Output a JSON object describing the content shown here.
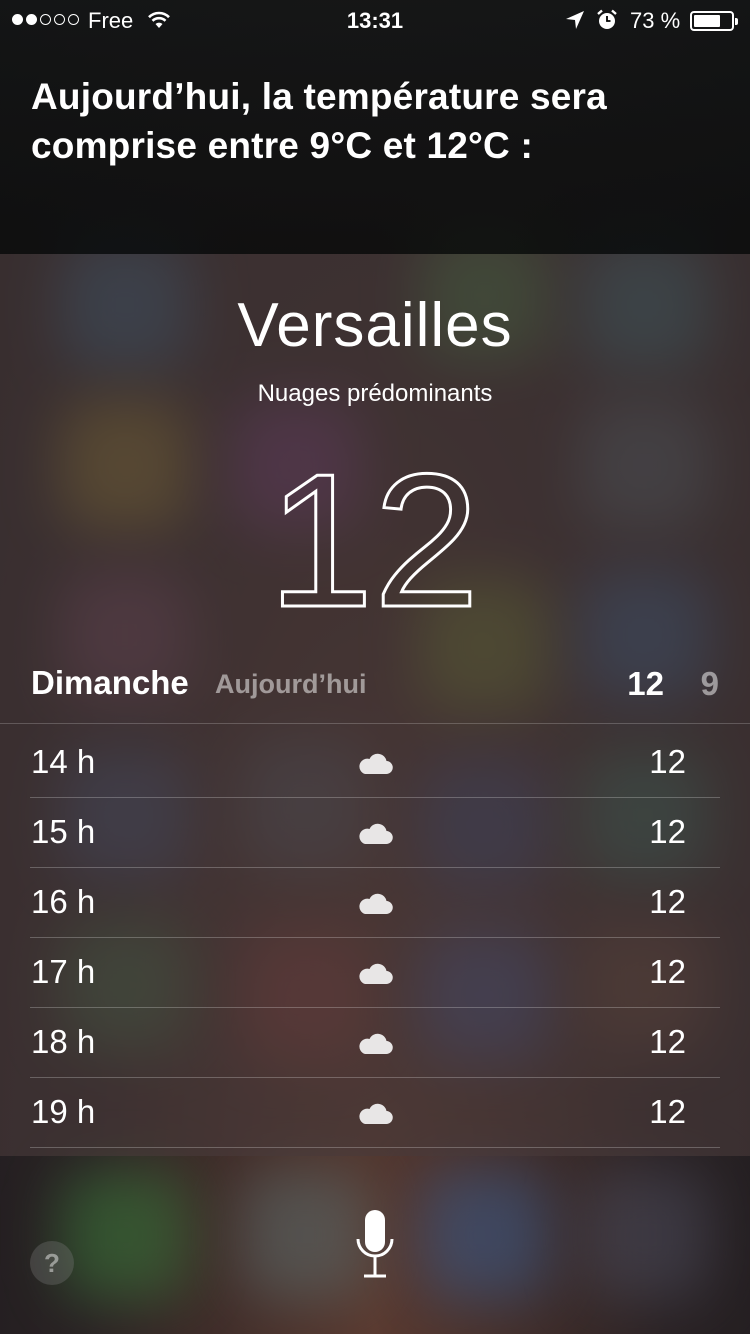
{
  "status_bar": {
    "signal_bars_filled": 2,
    "signal_bars_total": 5,
    "carrier": "Free",
    "time": "13:31",
    "battery_percent_label": "73 %",
    "battery_level": 0.73,
    "icons": [
      "wifi-icon",
      "location-arrow-icon",
      "alarm-icon",
      "battery-icon"
    ]
  },
  "siri": {
    "response_text": "Aujourd’hui, la température sera comprise entre 9°C et 12°C :"
  },
  "weather": {
    "city": "Versailles",
    "condition": "Nuages prédominants",
    "current_temp": "12°",
    "day": {
      "name": "Dimanche",
      "label": "Aujourd’hui",
      "high": "12",
      "low": "9"
    },
    "hourly": [
      {
        "hour": "14 h",
        "icon": "cloud-icon",
        "temp": "12"
      },
      {
        "hour": "15 h",
        "icon": "cloud-icon",
        "temp": "12"
      },
      {
        "hour": "16 h",
        "icon": "cloud-icon",
        "temp": "12"
      },
      {
        "hour": "17 h",
        "icon": "cloud-icon",
        "temp": "12"
      },
      {
        "hour": "18 h",
        "icon": "cloud-icon",
        "temp": "12"
      },
      {
        "hour": "19 h",
        "icon": "cloud-icon",
        "temp": "12"
      }
    ]
  },
  "bottom": {
    "help_label": "?",
    "mic_icon": "microphone-icon"
  }
}
